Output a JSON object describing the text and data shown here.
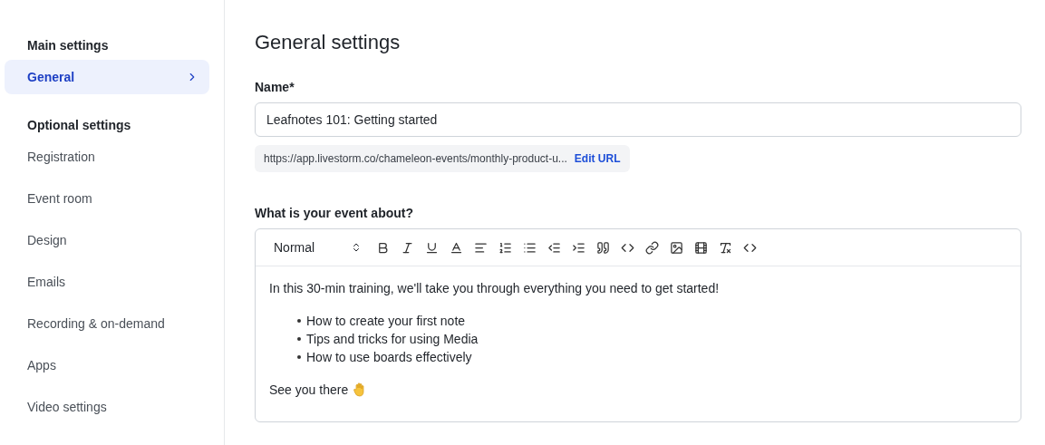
{
  "sidebar": {
    "sections": [
      {
        "heading": "Main settings",
        "items": [
          {
            "label": "General",
            "selected": true
          }
        ]
      },
      {
        "heading": "Optional settings",
        "items": [
          {
            "label": "Registration",
            "selected": false
          },
          {
            "label": "Event room",
            "selected": false
          },
          {
            "label": "Design",
            "selected": false
          },
          {
            "label": "Emails",
            "selected": false
          },
          {
            "label": "Recording & on-demand",
            "selected": false
          },
          {
            "label": "Apps",
            "selected": false
          },
          {
            "label": "Video settings",
            "selected": false
          }
        ]
      }
    ]
  },
  "page_title": "General settings",
  "name_field": {
    "label": "Name*",
    "value": "Leafnotes 101: Getting started"
  },
  "url": {
    "text": "https://app.livestorm.co/chameleon-events/monthly-product-u...",
    "link": "Edit URL"
  },
  "description": {
    "label": "What is your event about?",
    "format": "Normal",
    "intro": "In this 30-min training, we'll take you through everything you need to get started!",
    "bullets": [
      "How to create your first note",
      "Tips and tricks for using Media",
      "How to use boards effectively"
    ],
    "closing": "See you there"
  }
}
